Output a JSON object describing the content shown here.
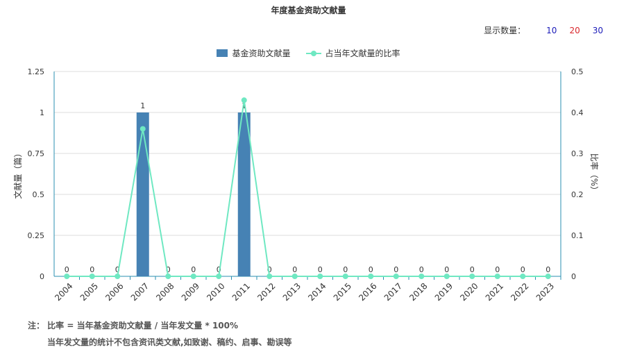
{
  "header": {
    "title": "年度基金资助文献量",
    "display_count_label": "显示数量：",
    "display_options": [
      {
        "label": "10",
        "color": "#1a1ab8"
      },
      {
        "label": "20",
        "color": "#d9262b"
      },
      {
        "label": "30",
        "color": "#1a1ab8"
      }
    ]
  },
  "notes": {
    "line1": "注： 比率 = 当年基金资助文献量 / 当年发文量 * 100%",
    "line2": "当年发文量的统计不包含资讯类文献,如致谢、稿约、启事、勘误等"
  },
  "chart_data": {
    "type": "bar",
    "title": "年度基金资助文献量",
    "categories": [
      "2004",
      "2005",
      "2006",
      "2007",
      "2008",
      "2009",
      "2010",
      "2011",
      "2012",
      "2013",
      "2014",
      "2015",
      "2016",
      "2017",
      "2018",
      "2019",
      "2020",
      "2021",
      "2022",
      "2023"
    ],
    "series": [
      {
        "name": "基金资助文献量",
        "type": "bar",
        "axis": "left",
        "color": "#4682b4",
        "values": [
          0,
          0,
          0,
          1,
          0,
          0,
          0,
          1,
          0,
          0,
          0,
          0,
          0,
          0,
          0,
          0,
          0,
          0,
          0,
          0
        ]
      },
      {
        "name": "占当年文献量的比率",
        "type": "line",
        "axis": "right",
        "color": "#6fe8c2",
        "values": [
          0,
          0,
          0,
          0.36,
          0,
          0,
          0,
          0.43,
          0,
          0,
          0,
          0,
          0,
          0,
          0,
          0,
          0,
          0,
          0,
          0
        ]
      }
    ],
    "ylabel_left": "文献量（篇）",
    "ylabel_right": "比率（%）",
    "ylim_left": [
      0,
      1.25
    ],
    "ylim_right": [
      0,
      0.5
    ],
    "yticks_left": [
      "0",
      "0.25",
      "0.5",
      "0.75",
      "1",
      "1.25"
    ],
    "yticks_right": [
      "0",
      "0.1",
      "0.2",
      "0.3",
      "0.4",
      "0.5"
    ],
    "grid": true,
    "legend_position": "top-center",
    "axis_color": "#2a8fb0",
    "bar_data_labels": true
  }
}
